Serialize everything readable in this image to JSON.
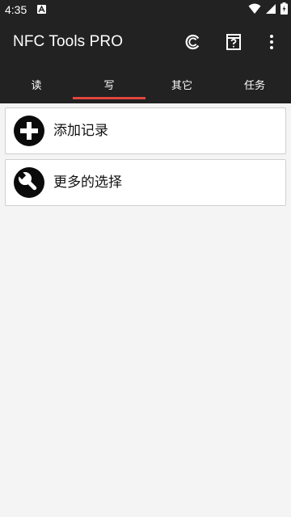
{
  "status_bar": {
    "time": "4:35"
  },
  "app_bar": {
    "title": "NFC Tools PRO",
    "actions": [
      "nfc-ring-icon",
      "help-icon",
      "more-vert-icon"
    ]
  },
  "tabs": [
    {
      "label": "读",
      "active": false
    },
    {
      "label": "写",
      "active": true
    },
    {
      "label": "其它",
      "active": false
    },
    {
      "label": "任务",
      "active": false
    }
  ],
  "records": [
    {
      "label": "添加记录",
      "icon": "add-circle-icon"
    },
    {
      "label": "更多的选择",
      "icon": "wrench-icon"
    }
  ],
  "colors": {
    "bar_background": "#222222",
    "tab_indicator": "#e2463e",
    "content_background": "#f4f4f4"
  }
}
